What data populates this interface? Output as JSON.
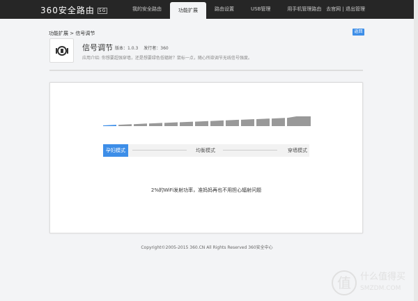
{
  "header": {
    "logo": "360安全路由",
    "logo_badge": "5G",
    "nav": [
      "我的安全路由",
      "功能扩展",
      "路由设置",
      "USB管理",
      "用手机管理路由"
    ],
    "active_index": 1,
    "links": [
      "去官网",
      "退出管理"
    ]
  },
  "breadcrumb": "功能扩展 > 信号调节",
  "back_label": "返回",
  "app": {
    "title": "信号调节",
    "version": "版本：1.0.3",
    "publisher": "发行者：360",
    "description": "应用介绍: 你想要超强穿墙，还是想要绿色低辐射？鼠标一点，随心所欲调节无线信号强度。"
  },
  "signal": {
    "levels": 13,
    "selected": 1,
    "modes": [
      "孕妇模式",
      "均衡模式",
      "穿墙模式"
    ],
    "active_mode": 0,
    "info": "2%的WiFi发射功率，准妈妈再也不用担心辐射问题"
  },
  "colors": {
    "accent": "#3d8ee8",
    "bar": "#999999"
  },
  "footer": "Copyright©2005-2015 360.CN All Rights Reserved 360安全中心",
  "watermark": {
    "glyph": "值",
    "text": "什么值得买",
    "domain": "SMZDM.COM"
  }
}
